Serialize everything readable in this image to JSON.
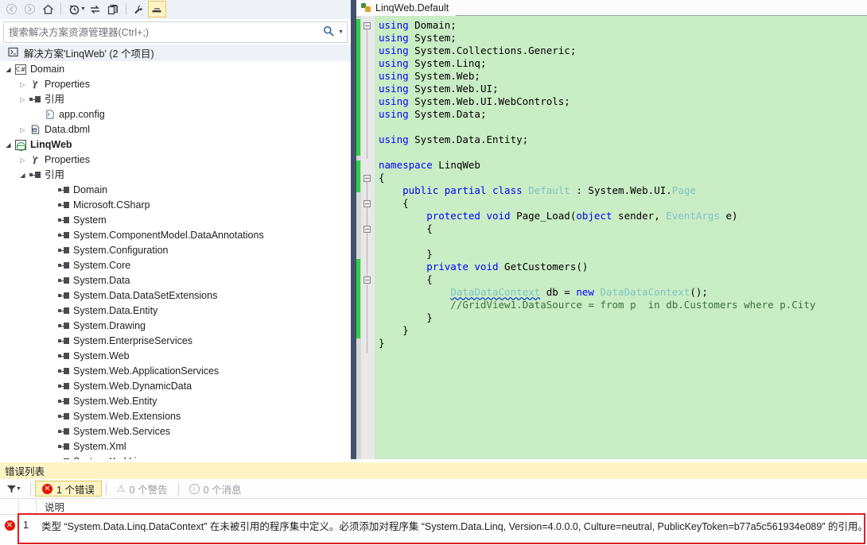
{
  "solution_explorer": {
    "toolbar": [
      {
        "name": "back-button",
        "glyph": "◀",
        "state": "disabled"
      },
      {
        "name": "forward-button",
        "glyph": "▶",
        "state": "disabled"
      },
      {
        "name": "home-button",
        "glyph": "⌂",
        "state": "normal"
      },
      {
        "name": "pending-changes-icon",
        "glyph": "◴",
        "state": "normal"
      },
      {
        "name": "sync-with-active-document-button",
        "glyph": "⇄",
        "state": "normal"
      },
      {
        "name": "show-all-files-button",
        "glyph": "⧉",
        "state": "normal"
      },
      {
        "name": "properties-button",
        "glyph": "⚒",
        "state": "normal"
      },
      {
        "name": "collapse-all-button",
        "glyph": "▄",
        "state": "active"
      }
    ],
    "search": {
      "placeholder": "搜索解决方案资源管理器(Ctrl+;)",
      "value": "",
      "icon": "search-icon"
    },
    "solution_row": {
      "icon": "solution-icon",
      "label": "解决方案'LinqWeb' (2 个项目)"
    },
    "tree": [
      {
        "indent": 1,
        "expander": "open",
        "icon": "csharp-project-icon",
        "label": "Domain",
        "bold": false
      },
      {
        "indent": 2,
        "expander": "collapsed",
        "icon": "wrench-icon",
        "label": "Properties",
        "bold": false
      },
      {
        "indent": 2,
        "expander": "collapsed",
        "icon": "references-icon",
        "label": "引用",
        "bold": false
      },
      {
        "indent": 3,
        "expander": "none",
        "icon": "config-file-icon",
        "label": "app.config",
        "bold": false
      },
      {
        "indent": 2,
        "expander": "collapsed",
        "icon": "dbml-file-icon",
        "label": "Data.dbml",
        "bold": false
      },
      {
        "indent": 1,
        "expander": "open",
        "icon": "web-project-icon",
        "label": "LinqWeb",
        "bold": true
      },
      {
        "indent": 2,
        "expander": "collapsed",
        "icon": "wrench-icon",
        "label": "Properties",
        "bold": false
      },
      {
        "indent": 2,
        "expander": "open",
        "icon": "references-icon",
        "label": "引用",
        "bold": false
      },
      {
        "indent": 4,
        "expander": "none",
        "icon": "references-icon",
        "label": "Domain",
        "bold": false
      },
      {
        "indent": 4,
        "expander": "none",
        "icon": "references-icon",
        "label": "Microsoft.CSharp",
        "bold": false
      },
      {
        "indent": 4,
        "expander": "none",
        "icon": "references-icon",
        "label": "System",
        "bold": false
      },
      {
        "indent": 4,
        "expander": "none",
        "icon": "references-icon",
        "label": "System.ComponentModel.DataAnnotations",
        "bold": false
      },
      {
        "indent": 4,
        "expander": "none",
        "icon": "references-icon",
        "label": "System.Configuration",
        "bold": false
      },
      {
        "indent": 4,
        "expander": "none",
        "icon": "references-icon",
        "label": "System.Core",
        "bold": false
      },
      {
        "indent": 4,
        "expander": "none",
        "icon": "references-icon",
        "label": "System.Data",
        "bold": false
      },
      {
        "indent": 4,
        "expander": "none",
        "icon": "references-icon",
        "label": "System.Data.DataSetExtensions",
        "bold": false
      },
      {
        "indent": 4,
        "expander": "none",
        "icon": "references-icon",
        "label": "System.Data.Entity",
        "bold": false
      },
      {
        "indent": 4,
        "expander": "none",
        "icon": "references-icon",
        "label": "System.Drawing",
        "bold": false
      },
      {
        "indent": 4,
        "expander": "none",
        "icon": "references-icon",
        "label": "System.EnterpriseServices",
        "bold": false
      },
      {
        "indent": 4,
        "expander": "none",
        "icon": "references-icon",
        "label": "System.Web",
        "bold": false
      },
      {
        "indent": 4,
        "expander": "none",
        "icon": "references-icon",
        "label": "System.Web.ApplicationServices",
        "bold": false
      },
      {
        "indent": 4,
        "expander": "none",
        "icon": "references-icon",
        "label": "System.Web.DynamicData",
        "bold": false
      },
      {
        "indent": 4,
        "expander": "none",
        "icon": "references-icon",
        "label": "System.Web.Entity",
        "bold": false
      },
      {
        "indent": 4,
        "expander": "none",
        "icon": "references-icon",
        "label": "System.Web.Extensions",
        "bold": false
      },
      {
        "indent": 4,
        "expander": "none",
        "icon": "references-icon",
        "label": "System.Web.Services",
        "bold": false
      },
      {
        "indent": 4,
        "expander": "none",
        "icon": "references-icon",
        "label": "System.Xml",
        "bold": false
      },
      {
        "indent": 4,
        "expander": "none",
        "icon": "references-icon",
        "label": "System.Xml.Linq",
        "bold": false
      }
    ]
  },
  "editor": {
    "tab": {
      "label": "LinqWeb.Default",
      "icon": "aspx-file-icon"
    },
    "code_lines": [
      [
        {
          "t": "using ",
          "c": "kw"
        },
        {
          "t": "Domain;",
          "c": ""
        }
      ],
      [
        {
          "t": "using ",
          "c": "kw"
        },
        {
          "t": "System;",
          "c": ""
        }
      ],
      [
        {
          "t": "using ",
          "c": "kw"
        },
        {
          "t": "System.Collections.Generic;",
          "c": ""
        }
      ],
      [
        {
          "t": "using ",
          "c": "kw"
        },
        {
          "t": "System.Linq;",
          "c": ""
        }
      ],
      [
        {
          "t": "using ",
          "c": "kw"
        },
        {
          "t": "System.Web;",
          "c": ""
        }
      ],
      [
        {
          "t": "using ",
          "c": "kw"
        },
        {
          "t": "System.Web.UI;",
          "c": ""
        }
      ],
      [
        {
          "t": "using ",
          "c": "kw"
        },
        {
          "t": "System.Web.UI.WebControls;",
          "c": ""
        }
      ],
      [
        {
          "t": "using ",
          "c": "kw"
        },
        {
          "t": "System.Data;",
          "c": ""
        }
      ],
      [],
      [
        {
          "t": "using ",
          "c": "kw"
        },
        {
          "t": "System.Data.Entity;",
          "c": ""
        }
      ],
      [],
      [
        {
          "t": "namespace ",
          "c": "kw"
        },
        {
          "t": "LinqWeb",
          "c": ""
        }
      ],
      [
        {
          "t": "{",
          "c": ""
        }
      ],
      [
        {
          "t": "    public partial class ",
          "c": "kw"
        },
        {
          "t": "Default",
          "c": "ty"
        },
        {
          "t": " : System.Web.UI.",
          "c": ""
        },
        {
          "t": "Page",
          "c": "ty"
        }
      ],
      [
        {
          "t": "    {",
          "c": ""
        }
      ],
      [
        {
          "t": "        protected void ",
          "c": "kw"
        },
        {
          "t": "Page_Load(",
          "c": ""
        },
        {
          "t": "object",
          "c": "kw"
        },
        {
          "t": " sender, ",
          "c": ""
        },
        {
          "t": "EventArgs",
          "c": "ty"
        },
        {
          "t": " e)",
          "c": ""
        }
      ],
      [
        {
          "t": "        {",
          "c": ""
        }
      ],
      [],
      [
        {
          "t": "        }",
          "c": ""
        }
      ],
      [
        {
          "t": "        private void ",
          "c": "kw"
        },
        {
          "t": "GetCustomers()",
          "c": ""
        }
      ],
      [
        {
          "t": "        {",
          "c": ""
        }
      ],
      [
        {
          "t": "            ",
          "c": ""
        },
        {
          "t": "DataDataContext",
          "c": "sq"
        },
        {
          "t": " db = ",
          "c": ""
        },
        {
          "t": "new ",
          "c": "kw"
        },
        {
          "t": "DataDataContext",
          "c": "ty"
        },
        {
          "t": "();",
          "c": ""
        }
      ],
      [
        {
          "t": "            //GridView1.DataSource = from p  in db.Customers where p.City",
          "c": "cm"
        }
      ],
      [
        {
          "t": "        }",
          "c": ""
        }
      ],
      [
        {
          "t": "    }",
          "c": ""
        }
      ],
      [
        {
          "t": "}",
          "c": ""
        }
      ]
    ]
  },
  "error_list": {
    "title": "错误列表",
    "filter_button": "filter-icon",
    "tabs": [
      {
        "name": "errors-filter",
        "label": "1 个错误",
        "icon": "error-badge",
        "active": true
      },
      {
        "name": "warnings-filter",
        "label": "0 个警告",
        "icon": "warning-badge",
        "active": false
      },
      {
        "name": "messages-filter",
        "label": "0 个消息",
        "icon": "info-badge",
        "active": false
      }
    ],
    "columns": [
      "",
      "",
      "说明"
    ],
    "rows": [
      {
        "icon": "error-badge",
        "num": "1",
        "description": "类型 “System.Data.Linq.DataContext” 在未被引用的程序集中定义。必须添加对程序集 “System.Data.Linq, Version=4.0.0.0, Culture=neutral, PublicKeyToken=b77a5c561934e089” 的引用。"
      }
    ]
  },
  "colors": {
    "editor_background": "#c9edc4",
    "change_bar": "#2ecf3f",
    "keyword": "#0000ff",
    "type": "#7ec4c4",
    "comment": "#3f6f3f",
    "error_red": "#e02020",
    "highlight_yellow": "#fdf3c4",
    "splitter": "#44516b"
  }
}
